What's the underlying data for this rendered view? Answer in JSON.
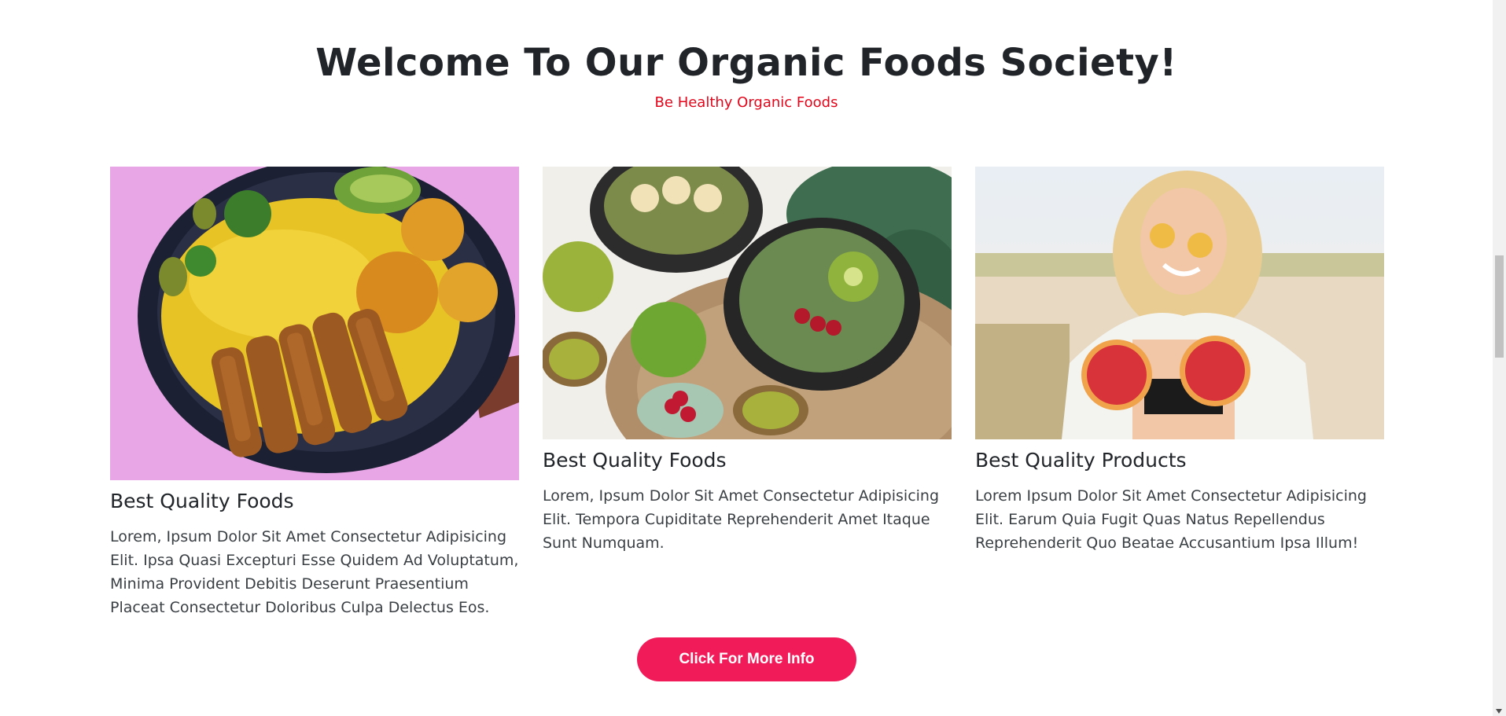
{
  "section": {
    "title": "Welcome To Our Organic Foods Society!",
    "subtitle": "Be Healthy Organic Foods"
  },
  "cards": [
    {
      "title": "Best Quality Foods",
      "text": "Lorem, Ipsum Dolor Sit Amet Consectetur Adipisicing Elit. Ipsa Quasi Excepturi Esse Quidem Ad Voluptatum, Minima Provident Debitis Deserunt Praesentium Placeat Consectetur Doloribus Culpa Delectus Eos."
    },
    {
      "title": "Best Quality Foods",
      "text": "Lorem, Ipsum Dolor Sit Amet Consectetur Adipisicing Elit. Tempora Cupiditate Reprehenderit Amet Itaque Sunt Numquam."
    },
    {
      "title": "Best Quality Products",
      "text": "Lorem Ipsum Dolor Sit Amet Consectetur Adipisicing Elit. Earum Quia Fugit Quas Natus Repellendus Reprehenderit Quo Beatae Accusantium Ipsa Illum!"
    }
  ],
  "cta_label": "Click For More Info",
  "colors": {
    "accent": "#f21b59",
    "subtitle": "#e3061b",
    "heading": "#212529"
  }
}
